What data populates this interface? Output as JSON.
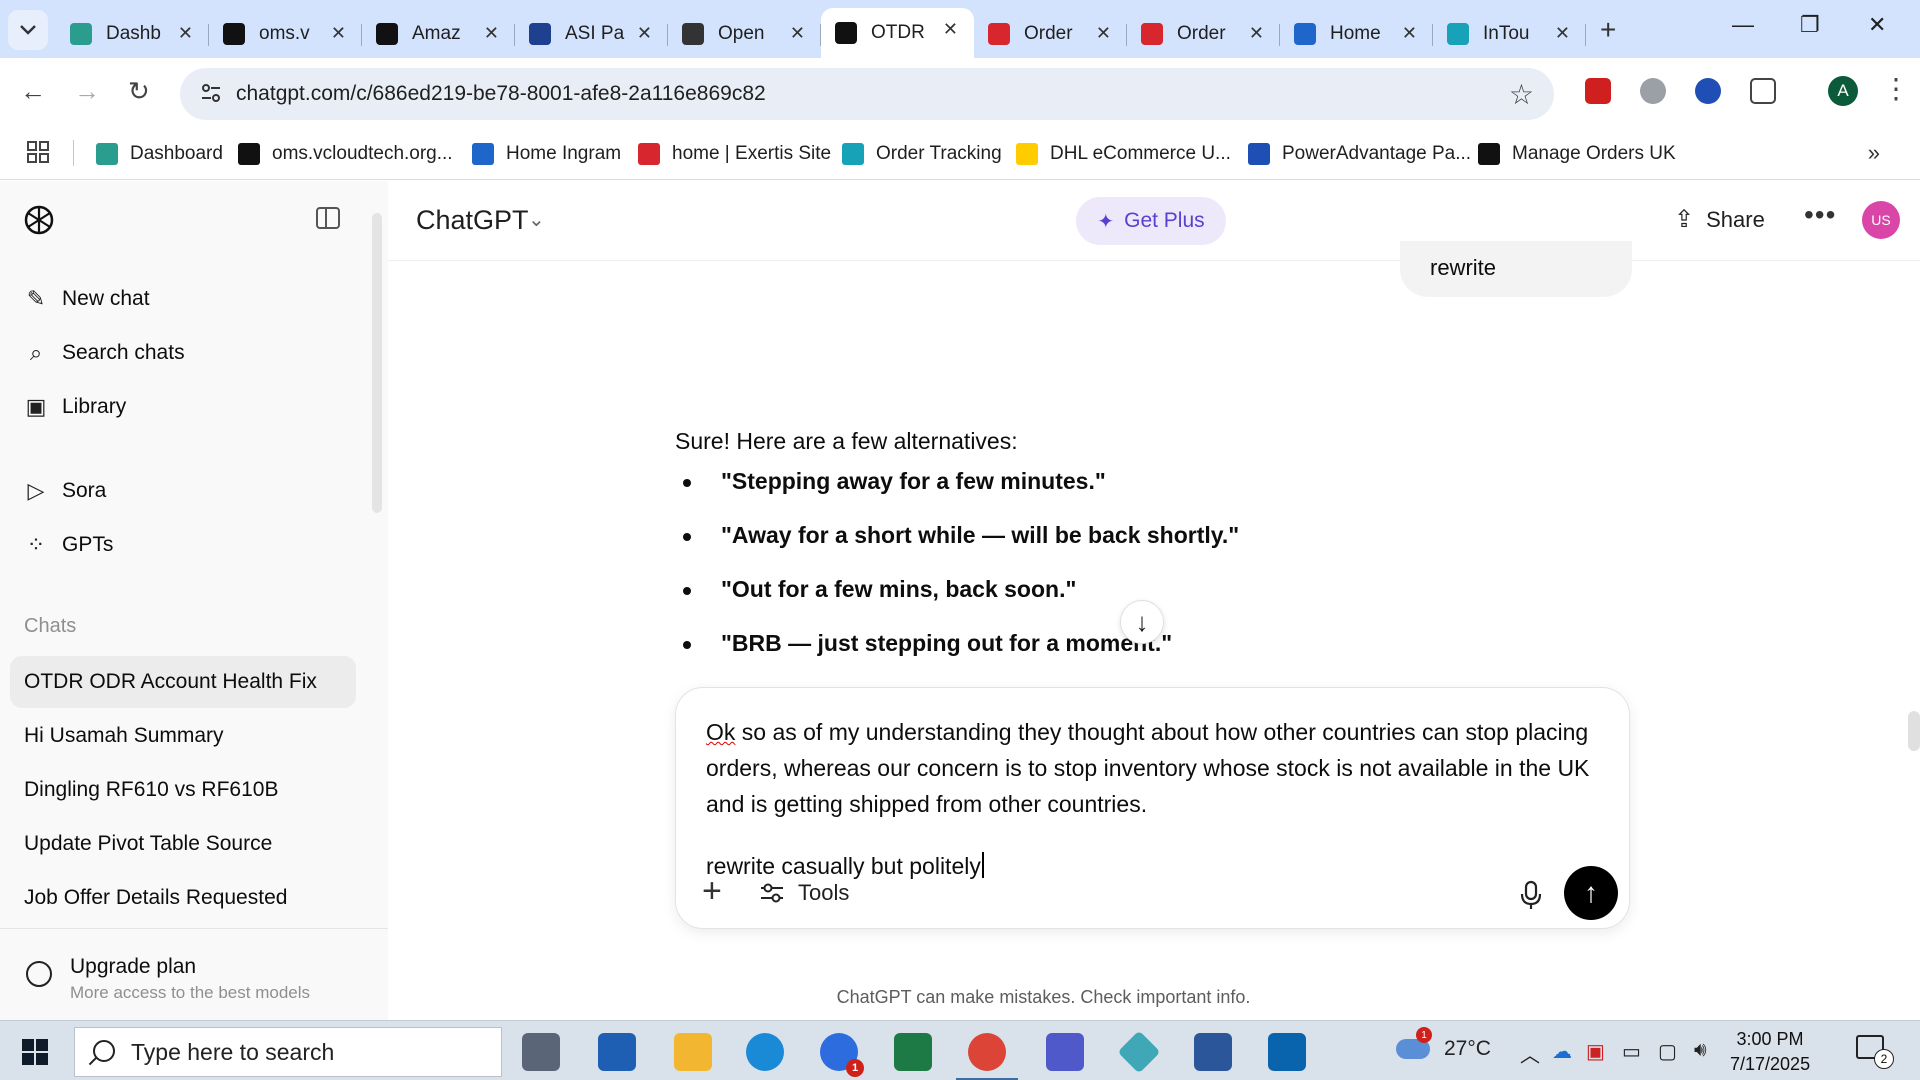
{
  "browser": {
    "tabs": [
      {
        "title": "Dashb",
        "favicon": "dashboard-icon",
        "color": "#2a9d8f"
      },
      {
        "title": "oms.v",
        "favicon": "triangle-logo-icon",
        "color": "#111111"
      },
      {
        "title": "Amaz",
        "favicon": "amazon-icon",
        "color": "#111111"
      },
      {
        "title": "ASI Pa",
        "favicon": "asi-arrow-icon",
        "color": "#1f3f8f"
      },
      {
        "title": "Open",
        "favicon": "openai-icon",
        "color": "#333333"
      },
      {
        "title": "OTDR",
        "favicon": "openai-icon",
        "color": "#111111",
        "active": true
      },
      {
        "title": "Order",
        "favicon": "exertis-icon",
        "color": "#d7262e"
      },
      {
        "title": "Order",
        "favicon": "exertis-icon",
        "color": "#d7262e"
      },
      {
        "title": "Home",
        "favicon": "ingram-icon",
        "color": "#1e66c9"
      },
      {
        "title": "InTou",
        "favicon": "intouch-icon",
        "color": "#17a2b8"
      }
    ],
    "close_glyph": "✕",
    "new_tab_glyph": "+",
    "url": "chatgpt.com/c/686ed219-be78-8001-afe8-2a116e869c82",
    "profile_initial": "A",
    "bookmarks": [
      {
        "label": "Dashboard",
        "icon": "dashboard-icon",
        "color": "#2a9d8f"
      },
      {
        "label": "oms.vcloudtech.org...",
        "icon": "triangle-logo-icon",
        "color": "#111111"
      },
      {
        "label": "Home Ingram",
        "icon": "ingram-icon",
        "color": "#1e66c9"
      },
      {
        "label": "home | Exertis Site",
        "icon": "exertis-icon",
        "color": "#d7262e"
      },
      {
        "label": "Order Tracking",
        "icon": "intouch-icon",
        "color": "#17a2b8"
      },
      {
        "label": "DHL eCommerce U...",
        "icon": "dhl-icon",
        "color": "#ffcc00"
      },
      {
        "label": "PowerAdvantage Pa...",
        "icon": "poweradvantage-icon",
        "color": "#1e4fb5"
      },
      {
        "label": "Manage Orders UK",
        "icon": "amazon-icon",
        "color": "#111111"
      }
    ]
  },
  "sidebar": {
    "nav": [
      {
        "label": "New chat",
        "icon": "compose-icon",
        "glyph": "✎"
      },
      {
        "label": "Search chats",
        "icon": "search-icon",
        "glyph": "⌕"
      },
      {
        "label": "Library",
        "icon": "library-icon",
        "glyph": "▣"
      },
      {
        "label": "Sora",
        "icon": "sora-play-icon",
        "glyph": "▷"
      },
      {
        "label": "GPTs",
        "icon": "gpts-grid-icon",
        "glyph": "⁘"
      }
    ],
    "section_label": "Chats",
    "chats": [
      {
        "label": "OTDR ODR Account Health Fix",
        "active": true
      },
      {
        "label": "Hi Usamah Summary"
      },
      {
        "label": "Dingling RF610 vs RF610B"
      },
      {
        "label": "Update Pivot Table Source"
      },
      {
        "label": "Job Offer Details Requested"
      }
    ],
    "upgrade": {
      "title": "Upgrade plan",
      "subtitle": "More access to the best models"
    }
  },
  "header": {
    "model": "ChatGPT",
    "chevron": "⌄",
    "get_plus": "Get Plus",
    "share": "Share",
    "more": "•••",
    "avatar": "US"
  },
  "conversation": {
    "user_message": "rewrite",
    "assistant_intro": "Sure! Here are a few alternatives:",
    "alternatives": [
      "\"Stepping away for a few minutes.\"",
      "\"Away for a short while — will be back shortly.\"",
      "\"Out for a few mins, back soon.\"",
      "\"BRB — just stepping out for a moment.\""
    ],
    "scroll_glyph": "↓"
  },
  "composer": {
    "first_word": "Ok",
    "line1_rest": " so as of my understanding they thought about how other countries can stop placing orders, whereas our concern is to stop inventory whose stock is not available in the UK and is getting shipped from other countries.",
    "line2": "rewrite casually but politely",
    "attach": "+",
    "tools": "Tools",
    "send_glyph": "↑"
  },
  "disclaimer": "ChatGPT can make mistakes. Check important info.",
  "taskbar": {
    "search_placeholder": "Type here to search",
    "teams_badge": "1",
    "weather_badge": "1",
    "temperature": "27°C",
    "time": "3:00 PM",
    "date": "7/17/2025",
    "notification_count": "2"
  }
}
